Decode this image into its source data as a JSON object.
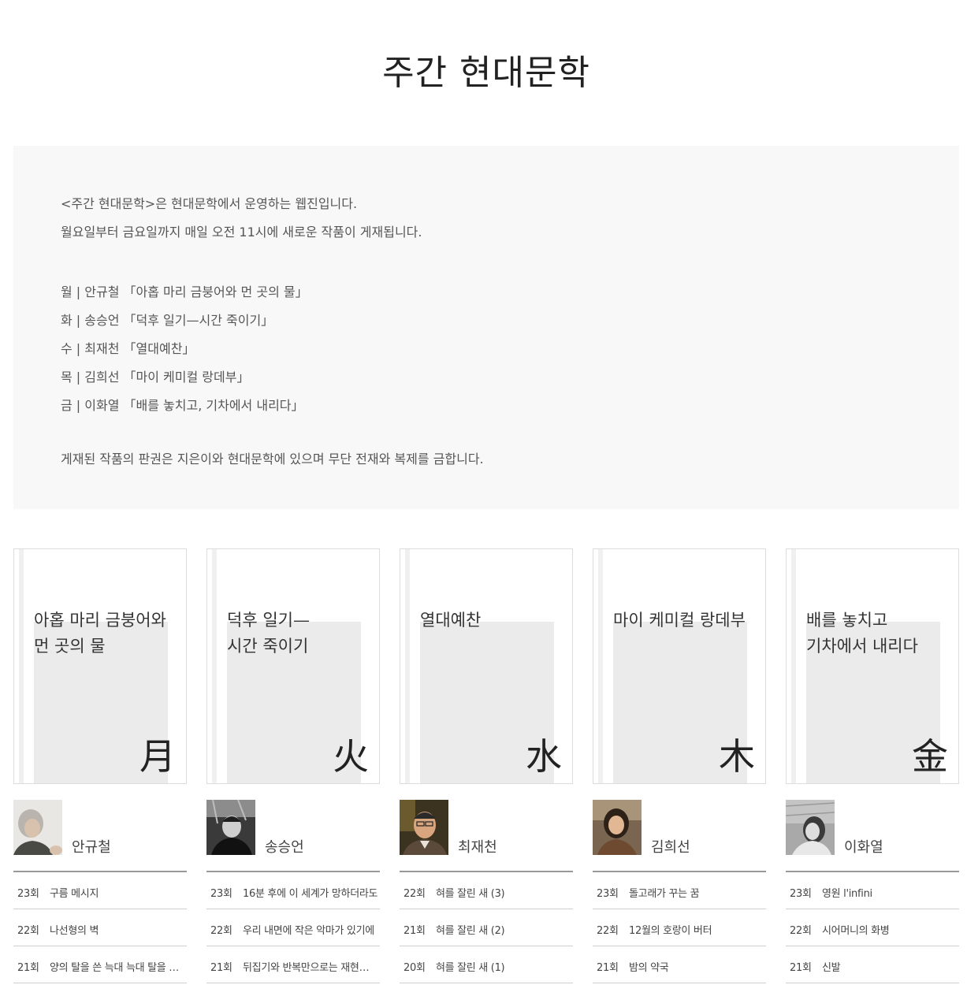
{
  "page": {
    "title": "주간 현대문학"
  },
  "intro": {
    "line1": "<주간 현대문학>은 현대문학에서 운영하는 웹진입니다.",
    "line2": "월요일부터 금요일까지 매일 오전 11시에 새로운 작품이 게재됩니다.",
    "schedule": [
      "월 | 안규철 「아홉 마리 금붕어와 먼 곳의 물」",
      "화 | 송승언 「덕후 일기—시간 죽이기」",
      "수 | 최재천 「열대예찬」",
      "목 | 김희선 「마이 케미컬 랑데부」",
      "금 | 이화열 「배를 놓치고, 기차에서 내리다」"
    ],
    "copyright": "게재된 작품의 판권은 지은이와 현대문학에 있으며 무단 전재와 복제를 금합니다."
  },
  "columns": [
    {
      "title": "아홉 마리 금붕어와\n먼 곳의 물",
      "day": "月",
      "author": "안규철",
      "episodes": [
        {
          "num": "23회",
          "title": "구름 메시지"
        },
        {
          "num": "22회",
          "title": "나선형의 벽"
        },
        {
          "num": "21회",
          "title": "양의 탈을 쓴 늑대 늑대 탈을 쓴 양"
        }
      ]
    },
    {
      "title": "덕후 일기—\n시간 죽이기",
      "day": "火",
      "author": "송승언",
      "episodes": [
        {
          "num": "23회",
          "title": "16분 후에 이 세계가 망하더라도"
        },
        {
          "num": "22회",
          "title": "우리 내면에 작은 악마가 있기에"
        },
        {
          "num": "21회",
          "title": "뒤집기와 반복만으로는 재현할 수 없는"
        }
      ]
    },
    {
      "title": "열대예찬",
      "day": "水",
      "author": "최재천",
      "episodes": [
        {
          "num": "22회",
          "title": "혀를 잘린 새 (3)"
        },
        {
          "num": "21회",
          "title": "혀를 잘린 새 (2)"
        },
        {
          "num": "20회",
          "title": "혀를 잘린 새 (1)"
        }
      ]
    },
    {
      "title": "마이 케미컬 랑데부",
      "day": "木",
      "author": "김희선",
      "episodes": [
        {
          "num": "23회",
          "title": "돌고래가 꾸는 꿈"
        },
        {
          "num": "22회",
          "title": "12월의 호랑이 버터"
        },
        {
          "num": "21회",
          "title": "밤의 약국"
        }
      ]
    },
    {
      "title": "배를 놓치고\n기차에서 내리다",
      "day": "金",
      "author": "이화열",
      "episodes": [
        {
          "num": "23회",
          "title": "영원 l'infini"
        },
        {
          "num": "22회",
          "title": "시어머니의 화병"
        },
        {
          "num": "21회",
          "title": "신발"
        }
      ]
    }
  ]
}
